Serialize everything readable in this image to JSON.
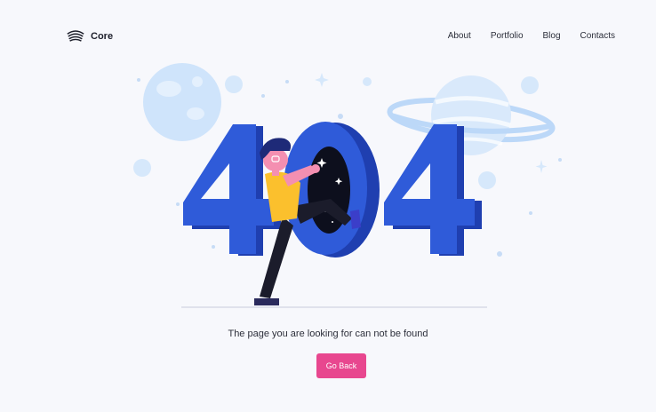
{
  "brand": {
    "name": "Core"
  },
  "nav": {
    "items": [
      {
        "label": "About"
      },
      {
        "label": "Portfolio"
      },
      {
        "label": "Blog"
      },
      {
        "label": "Contacts"
      }
    ]
  },
  "illustration": {
    "code_text": "404"
  },
  "main": {
    "message": "The page you are looking for can not be found",
    "button_label": "Go Back"
  },
  "colors": {
    "background": "#f7f8fc",
    "accent_pink": "#e8478f",
    "number_blue": "#2f5bd9",
    "number_shadow": "#1f3fb0",
    "planet_light": "#cfe4fb"
  }
}
